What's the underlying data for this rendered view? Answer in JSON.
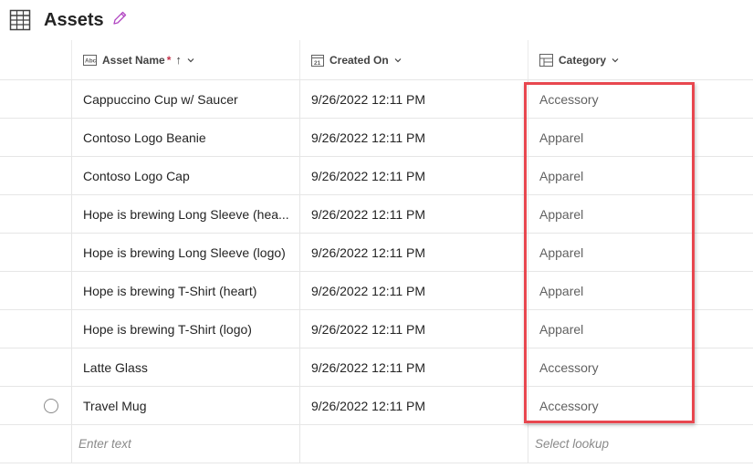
{
  "header": {
    "title": "Assets",
    "table_icon": "table-grid-icon",
    "edit_icon": "pencil-icon"
  },
  "columns": [
    {
      "label": "Asset Name",
      "icon": "text-field-icon",
      "required": "*",
      "sort": "↑",
      "chevron": "chevron-down-icon"
    },
    {
      "label": "Created On",
      "icon": "calendar-icon",
      "calendar_day": "21",
      "chevron": "chevron-down-icon"
    },
    {
      "label": "Category",
      "icon": "choice-field-icon",
      "chevron": "chevron-down-icon"
    }
  ],
  "rows": [
    {
      "name": "Cappuccino Cup w/ Saucer",
      "created": "9/26/2022 12:11 PM",
      "category": "Accessory"
    },
    {
      "name": "Contoso Logo Beanie",
      "created": "9/26/2022 12:11 PM",
      "category": "Apparel"
    },
    {
      "name": "Contoso Logo Cap",
      "created": "9/26/2022 12:11 PM",
      "category": "Apparel"
    },
    {
      "name": "Hope is brewing Long Sleeve (hea...",
      "created": "9/26/2022 12:11 PM",
      "category": "Apparel"
    },
    {
      "name": "Hope is brewing Long Sleeve (logo)",
      "created": "9/26/2022 12:11 PM",
      "category": "Apparel"
    },
    {
      "name": "Hope is brewing T-Shirt (heart)",
      "created": "9/26/2022 12:11 PM",
      "category": "Apparel"
    },
    {
      "name": "Hope is brewing T-Shirt (logo)",
      "created": "9/26/2022 12:11 PM",
      "category": "Apparel"
    },
    {
      "name": "Latte Glass",
      "created": "9/26/2022 12:11 PM",
      "category": "Accessory"
    },
    {
      "name": "Travel Mug",
      "created": "9/26/2022 12:11 PM",
      "category": "Accessory"
    }
  ],
  "new_row": {
    "name_placeholder": "Enter text",
    "category_placeholder": "Select lookup"
  },
  "colors": {
    "highlight": "#e8474f",
    "required": "#c4314b"
  }
}
